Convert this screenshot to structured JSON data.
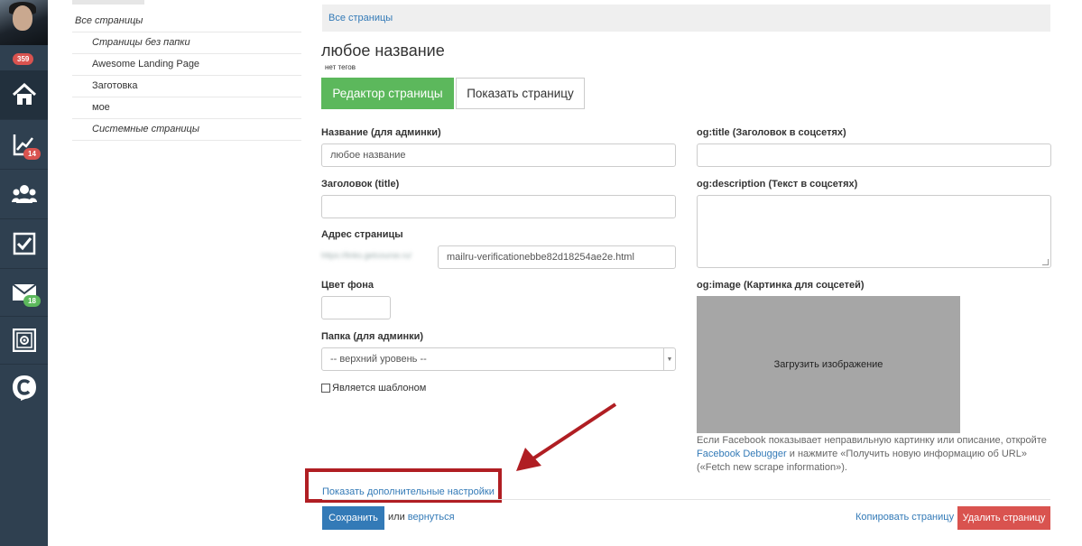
{
  "sidebar": {
    "badges": {
      "profile": "359",
      "analytics": "14",
      "messages": "18"
    },
    "icons": [
      "home-icon",
      "chart-icon",
      "users-icon",
      "tasks-icon",
      "mail-icon",
      "settings-icon",
      "logo-icon"
    ]
  },
  "folders": {
    "root": "Все страницы",
    "items": [
      {
        "label": "Страницы без папки",
        "italic": true
      },
      {
        "label": "Awesome Landing Page",
        "italic": false
      },
      {
        "label": "Заготовка",
        "italic": false
      },
      {
        "label": "мое",
        "italic": false
      },
      {
        "label": "Системные страницы",
        "italic": true
      }
    ]
  },
  "breadcrumb": "Все страницы",
  "page": {
    "title": "любое название",
    "tags": "нет тегов",
    "editor_button": "Редактор страницы",
    "show_button": "Показать страницу"
  },
  "form": {
    "name_label": "Название (для админки)",
    "name_value": "любое название",
    "title_label": "Заголовок (title)",
    "title_value": "",
    "address_label": "Адрес страницы",
    "address_prefix": "https://links.getcourse.ru/",
    "address_value": "mailru-verificationebbe82d18254ae2e.html",
    "bg_label": "Цвет фона",
    "bg_value": "",
    "folder_label": "Папка (для админки)",
    "folder_value": "-- верхний уровень --",
    "template_label": "Является шаблоном",
    "og_title_label": "og:title (Заголовок в соцсетях)",
    "og_title_value": "",
    "og_desc_label": "og:description (Текст в соцсетях)",
    "og_desc_value": "",
    "og_image_label": "og:image (Картинка для соцсетей)",
    "upload_label": "Загрузить изображение",
    "fb_note_1": "Если Facebook показывает неправильную картинку или описание, откройте",
    "fb_link": "Facebook Debugger",
    "fb_note_2": "и нажмите «Получить новую информацию об URL» («Fetch new scrape information»)."
  },
  "footer": {
    "more_settings": "Показать дополнительные настройки",
    "save": "Сохранить",
    "or": "или",
    "back": "вернуться",
    "copy": "Копировать страницу",
    "delete": "Удалить страницу"
  },
  "colors": {
    "rail": "#2f4050",
    "primary": "#337ab7",
    "success": "#5cb85c",
    "danger": "#d9534f",
    "highlight": "#b01e23"
  }
}
